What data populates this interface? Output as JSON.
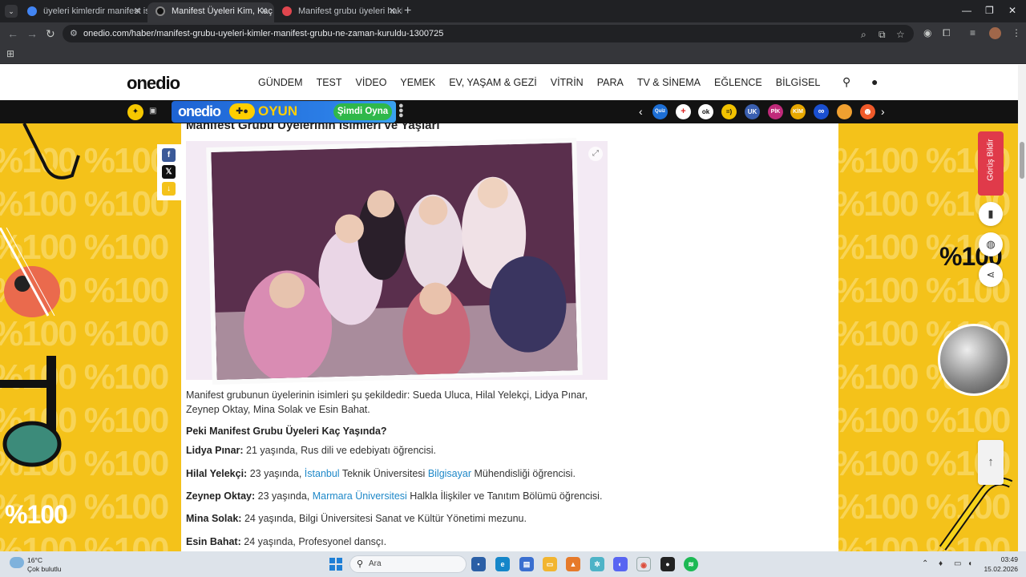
{
  "browser": {
    "tabs": [
      {
        "title": "üyeleri kimlerdir manifest isimle",
        "favicon_color": "#4285f4"
      },
      {
        "title": "Manifest Üyeleri Kim, Kaç Yaşın",
        "favicon_color": "#111111"
      },
      {
        "title": "Manifest grubu üyeleri hakkında",
        "favicon_color": "#e0464e"
      }
    ],
    "url": "onedio.com/haber/manifest-grubu-uyeleri-kimler-manifest-grubu-ne-zaman-kuruldu-1300725"
  },
  "site": {
    "logo": "onedio",
    "nav": [
      "GÜNDEM",
      "TEST",
      "VİDEO",
      "YEMEK",
      "EV, YAŞAM & GEZİ",
      "VİTRİN",
      "PARA",
      "TV & SİNEMA",
      "EĞLENCE",
      "BİLGİSEL"
    ],
    "gamebar": {
      "brand": "onedio",
      "game_label": "OYUN",
      "play_label": "Şimdi Oyna",
      "games": [
        {
          "label": "Quiz",
          "color": "#1d6fd6"
        },
        {
          "label": "+",
          "color": "#ffffff"
        },
        {
          "label": "ok",
          "color": "#ffffff"
        },
        {
          "label": "=)",
          "color": "#f2c200"
        },
        {
          "label": "UK",
          "color": "#3a5fb0"
        },
        {
          "label": "PİK",
          "color": "#c02a7a"
        },
        {
          "label": "KİM",
          "color": "#e8a800"
        },
        {
          "label": "∞",
          "color": "#1a4fd0"
        },
        {
          "label": "●",
          "color": "#f0a030"
        },
        {
          "label": "☻",
          "color": "#f05a2a"
        }
      ]
    }
  },
  "article": {
    "section_title": "Manifest Grubu Üyelerinin İsimleri ve Yaşları",
    "intro": "Manifest grubunun üyelerinin isimleri şu şekildedir: Sueda Uluca, Hilal Yelekçi, Lidya Pınar, Zeynep Oktay, Mina Solak ve Esin Bahat.",
    "subheading": "Peki Manifest Grubu Üyeleri Kaç Yaşında?",
    "members": [
      {
        "name": "Lidya Pınar:",
        "pre": " 21 yaşında, Rus dili ve edebiyatı öğrencisi.",
        "link1": "",
        "mid": "",
        "link2": "",
        "post": ""
      },
      {
        "name": "Hilal Yelekçi:",
        "pre": " 23 yaşında, ",
        "link1": "İstanbul",
        "mid": " Teknik Üniversitesi ",
        "link2": "Bilgisayar",
        "post": " Mühendisliği öğrencisi."
      },
      {
        "name": "Zeynep Oktay:",
        "pre": " 23 yaşında, ",
        "link1": "Marmara Üniversitesi",
        "mid": " Halkla İlişkiler ve Tanıtım Bölümü öğrencisi.",
        "link2": "",
        "post": ""
      },
      {
        "name": "Mina Solak:",
        "pre": " 24 yaşında, Bilgi Üniversitesi Sanat ve Kültür Yönetimi mezunu.",
        "link1": "",
        "mid": "",
        "link2": "",
        "post": ""
      },
      {
        "name": "Esin Bahat:",
        "pre": " 24 yaşında, Profesyonel dansçı.",
        "link1": "",
        "mid": "",
        "link2": "",
        "post": ""
      }
    ]
  },
  "side": {
    "feedback_label": "Görüş Bildir",
    "brand": "%100"
  },
  "taskbar": {
    "weather_temp": "16°C",
    "weather_desc": "Çok bulutlu",
    "search_placeholder": "Ara",
    "time": "03:49",
    "date": "15.02.2026"
  },
  "colors": {
    "accent_yellow": "#f4c21a",
    "link_blue": "#1e88c8",
    "feedback_red": "#e03a4a",
    "play_green": "#2fb84a"
  }
}
